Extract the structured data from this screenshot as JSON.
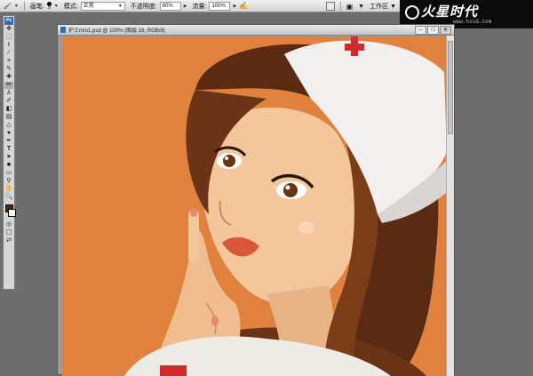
{
  "options_bar": {
    "brush_label": "画笔:",
    "brush_size": "9",
    "mode_label": "模式:",
    "mode_value": "正常",
    "opacity_label": "不透明度:",
    "opacity_value": "80%",
    "flow_label": "流量:",
    "flow_value": "100%",
    "workspace_label": "工作区"
  },
  "logo": {
    "text": "火星时代",
    "url": "www.hxsd.com"
  },
  "toolbox": {
    "badge": "Ps",
    "tools": [
      "move",
      "marquee",
      "lasso",
      "magic-wand",
      "crop",
      "slice",
      "healing-brush",
      "brush",
      "clone-stamp",
      "history-brush",
      "eraser",
      "gradient",
      "blur",
      "dodge",
      "pen",
      "type",
      "path-selection",
      "shape",
      "notes",
      "eyedropper",
      "hand",
      "zoom"
    ],
    "foreground_color": "#4a2614",
    "background_color": "#ffffff"
  },
  "document": {
    "title": "护士mm1.psd @ 100% (图层 16, RGB/8)",
    "canvas_bg": "#e0823d"
  }
}
